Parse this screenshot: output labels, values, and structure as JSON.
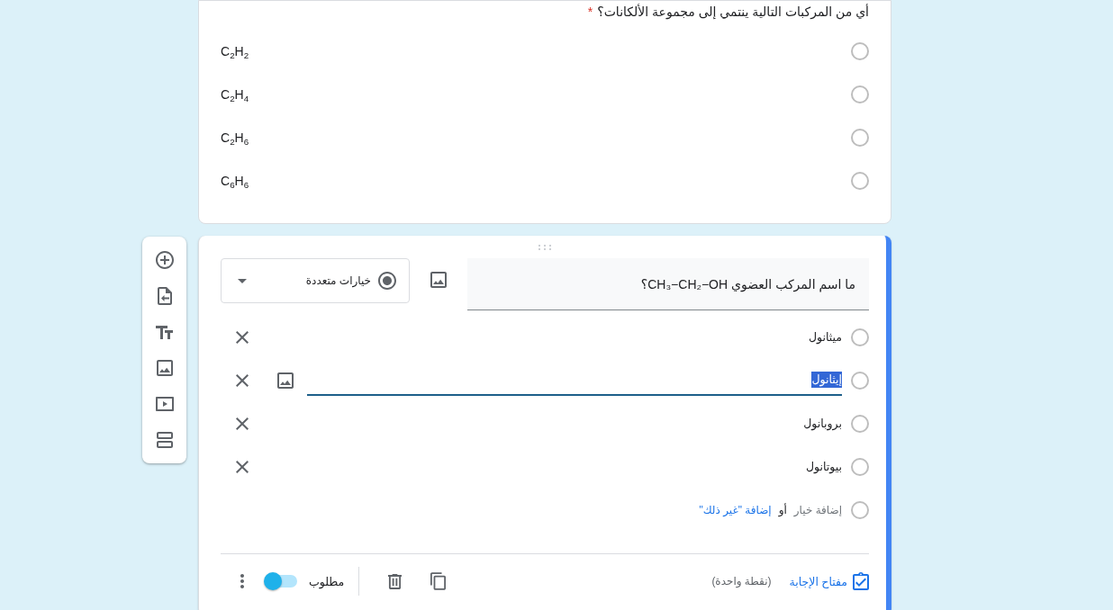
{
  "questions": [
    {
      "kind": "view",
      "title": "أي من المركبات التالية ينتمي إلى مجموعة الألكانات؟",
      "required_mark": "*",
      "options": [
        {
          "label": "C$_{2}$H$_{2}$",
          "selected": false
        },
        {
          "label": "C$_{2}$H$_{4}$",
          "selected": false
        },
        {
          "label": "C$_{2}$H$_{6}$",
          "selected": false
        },
        {
          "label": "C$_{6}$H$_{6}$",
          "selected": false
        }
      ]
    },
    {
      "kind": "edit",
      "title": "ما اسم المركب العضوي CH₃−CH₂−OH؟",
      "question_type": "خيارات متعددة",
      "options": [
        {
          "label": "ميثانول",
          "editing": false
        },
        {
          "label": "إيثانول",
          "editing": true
        },
        {
          "label": "بروبانول",
          "editing": false
        },
        {
          "label": "بيوتانول",
          "editing": false
        }
      ],
      "add_option": "إضافة خيار",
      "or": "أو",
      "add_other": "إضافة \"غير ذلك\"",
      "answer_key": "مفتاح الإجابة",
      "points": "(نقطة واحدة)",
      "required_label": "مطلوب",
      "required": true
    }
  ]
}
